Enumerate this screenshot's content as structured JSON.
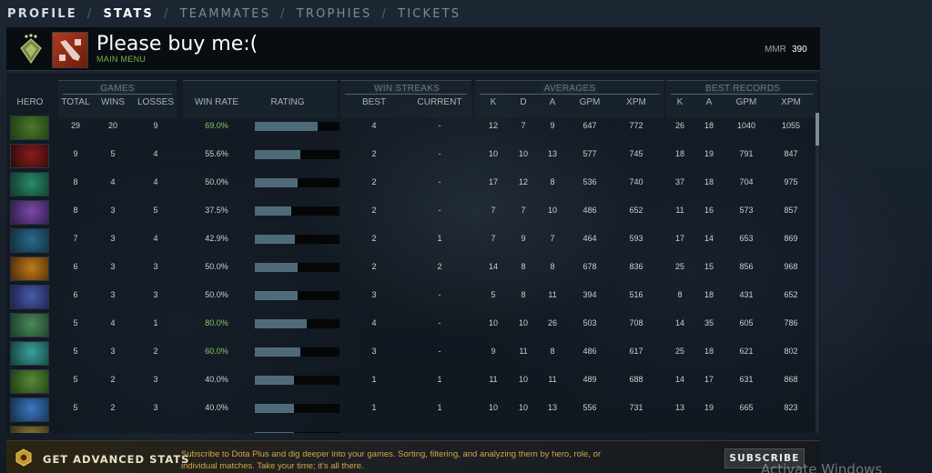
{
  "nav": {
    "items": [
      "PROFILE",
      "STATS",
      "TEAMMATES",
      "TROPHIES",
      "TICKETS"
    ],
    "separator": "/",
    "active": "STATS"
  },
  "profile": {
    "name": "Please buy me:(",
    "subtitle": "MAIN MENU",
    "mmr_label": "MMR",
    "mmr_value": "390"
  },
  "table": {
    "groups": {
      "games": "GAMES",
      "win_streaks": "WIN STREAKS",
      "averages": "AVERAGES",
      "best_records": "BEST RECORDS"
    },
    "columns": {
      "hero": "HERO",
      "total": "TOTAL",
      "wins": "WINS",
      "losses": "LOSSES",
      "win_rate": "WIN RATE",
      "rating": "RATING",
      "best": "BEST",
      "current": "CURRENT",
      "avg_k": "K",
      "avg_d": "D",
      "avg_a": "A",
      "avg_gpm": "GPM",
      "avg_xpm": "XPM",
      "best_k": "K",
      "best_a": "A",
      "best_gpm": "GPM",
      "best_xpm": "XPM"
    },
    "rows": [
      {
        "total": "29",
        "wins": "20",
        "losses": "9",
        "win_rate": "69.0%",
        "rating": 0.74,
        "best": "4",
        "current": "-",
        "k": "12",
        "d": "7",
        "a": "9",
        "gpm": "647",
        "xpm": "772",
        "bk": "26",
        "ba": "18",
        "bgpm": "1040",
        "bxpm": "1055",
        "good": true
      },
      {
        "total": "9",
        "wins": "5",
        "losses": "4",
        "win_rate": "55.6%",
        "rating": 0.54,
        "best": "2",
        "current": "-",
        "k": "10",
        "d": "10",
        "a": "13",
        "gpm": "577",
        "xpm": "745",
        "bk": "18",
        "ba": "19",
        "bgpm": "791",
        "bxpm": "847",
        "good": false
      },
      {
        "total": "8",
        "wins": "4",
        "losses": "4",
        "win_rate": "50.0%",
        "rating": 0.5,
        "best": "2",
        "current": "-",
        "k": "17",
        "d": "12",
        "a": "8",
        "gpm": "536",
        "xpm": "740",
        "bk": "37",
        "ba": "18",
        "bgpm": "704",
        "bxpm": "975",
        "good": false
      },
      {
        "total": "8",
        "wins": "3",
        "losses": "5",
        "win_rate": "37.5%",
        "rating": 0.43,
        "best": "2",
        "current": "-",
        "k": "7",
        "d": "7",
        "a": "10",
        "gpm": "486",
        "xpm": "652",
        "bk": "11",
        "ba": "16",
        "bgpm": "573",
        "bxpm": "857",
        "good": false
      },
      {
        "total": "7",
        "wins": "3",
        "losses": "4",
        "win_rate": "42.9%",
        "rating": 0.47,
        "best": "2",
        "current": "1",
        "k": "7",
        "d": "9",
        "a": "7",
        "gpm": "464",
        "xpm": "593",
        "bk": "17",
        "ba": "14",
        "bgpm": "653",
        "bxpm": "869",
        "good": false
      },
      {
        "total": "6",
        "wins": "3",
        "losses": "3",
        "win_rate": "50.0%",
        "rating": 0.5,
        "best": "2",
        "current": "2",
        "k": "14",
        "d": "8",
        "a": "8",
        "gpm": "678",
        "xpm": "836",
        "bk": "25",
        "ba": "15",
        "bgpm": "856",
        "bxpm": "968",
        "good": false
      },
      {
        "total": "6",
        "wins": "3",
        "losses": "3",
        "win_rate": "50.0%",
        "rating": 0.5,
        "best": "3",
        "current": "-",
        "k": "5",
        "d": "8",
        "a": "11",
        "gpm": "394",
        "xpm": "516",
        "bk": "8",
        "ba": "18",
        "bgpm": "431",
        "bxpm": "652",
        "good": false
      },
      {
        "total": "5",
        "wins": "4",
        "losses": "1",
        "win_rate": "80.0%",
        "rating": 0.61,
        "best": "4",
        "current": "-",
        "k": "10",
        "d": "10",
        "a": "26",
        "gpm": "503",
        "xpm": "708",
        "bk": "14",
        "ba": "35",
        "bgpm": "605",
        "bxpm": "786",
        "good": true
      },
      {
        "total": "5",
        "wins": "3",
        "losses": "2",
        "win_rate": "60.0%",
        "rating": 0.54,
        "best": "3",
        "current": "-",
        "k": "9",
        "d": "11",
        "a": "8",
        "gpm": "486",
        "xpm": "617",
        "bk": "25",
        "ba": "18",
        "bgpm": "621",
        "bxpm": "802",
        "good": true
      },
      {
        "total": "5",
        "wins": "2",
        "losses": "3",
        "win_rate": "40.0%",
        "rating": 0.46,
        "best": "1",
        "current": "1",
        "k": "11",
        "d": "10",
        "a": "11",
        "gpm": "489",
        "xpm": "688",
        "bk": "14",
        "ba": "17",
        "bgpm": "631",
        "bxpm": "868",
        "good": false
      },
      {
        "total": "5",
        "wins": "2",
        "losses": "3",
        "win_rate": "40.0%",
        "rating": 0.46,
        "best": "1",
        "current": "1",
        "k": "10",
        "d": "10",
        "a": "13",
        "gpm": "556",
        "xpm": "731",
        "bk": "13",
        "ba": "19",
        "bgpm": "665",
        "bxpm": "823",
        "good": false
      }
    ],
    "partial_row_rating": 0.46
  },
  "banner": {
    "title": "GET ADVANCED STATS",
    "text": "Subscribe to Dota Plus and dig deeper into your games. Sorting, filtering, and analyzing them by hero, role, or individual matches. Take your time; it's all there.",
    "button": "SUBSCRIBE"
  },
  "watermark": "Activate Windows",
  "colors": {
    "accent_green": "#8dc26b",
    "rating_fill": "#4f6b7a",
    "banner_text": "#d1a64c"
  },
  "icons": {
    "rank": "rank-medal-icon",
    "app": "dota-logo-icon",
    "plus": "dota-plus-icon"
  }
}
